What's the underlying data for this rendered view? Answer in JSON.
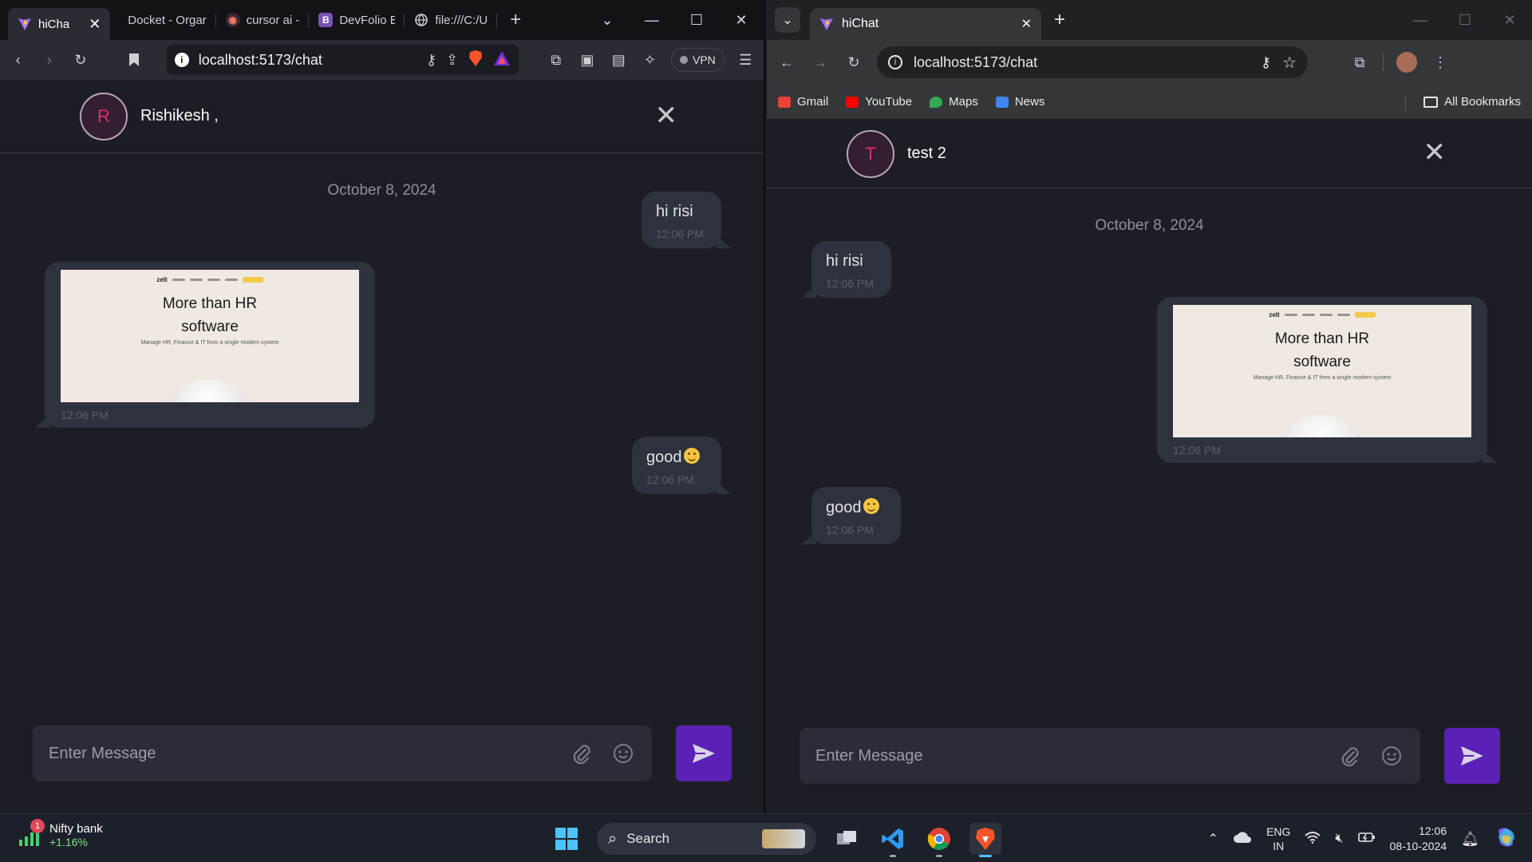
{
  "left_browser": {
    "tabs": [
      {
        "label": "hiCha",
        "active": true,
        "favicon": "vite-logo-icon"
      },
      {
        "label": "Docket - Orgar",
        "favicon": "none"
      },
      {
        "label": "cursor ai -",
        "favicon": "brave-search-icon"
      },
      {
        "label": "DevFolio E",
        "favicon": "bootstrap-icon"
      },
      {
        "label": "file:///C:/U",
        "favicon": "globe-icon"
      }
    ],
    "url": "localhost:5173/chat",
    "vpn_label": "VPN"
  },
  "right_browser": {
    "tab": {
      "label": "hiChat",
      "favicon": "vite-logo-icon"
    },
    "url": "localhost:5173/chat",
    "bookmarks": [
      {
        "label": "Gmail",
        "color": "#ea4335"
      },
      {
        "label": "YouTube",
        "color": "#ff0000"
      },
      {
        "label": "Maps",
        "color": "#34a853"
      },
      {
        "label": "News",
        "color": "#4285f4"
      }
    ],
    "all_bookmarks": "All Bookmarks"
  },
  "left_chat": {
    "contact": {
      "initial": "R",
      "name": "Rishikesh ,"
    },
    "date": "October 8, 2024",
    "messages": [
      {
        "text": "hi risi",
        "time": "12:06 PM",
        "dir": "out"
      },
      {
        "type": "image",
        "time": "12:06 PM",
        "dir": "in"
      },
      {
        "text": "good",
        "time": "12:06 PM",
        "dir": "out"
      }
    ],
    "input_placeholder": "Enter Message"
  },
  "right_chat": {
    "contact": {
      "initial": "T",
      "name": "test 2"
    },
    "date": "October 8, 2024",
    "messages": [
      {
        "text": "hi risi",
        "time": "12:06 PM",
        "dir": "in"
      },
      {
        "type": "image",
        "time": "12:06 PM",
        "dir": "out"
      },
      {
        "text": "good",
        "time": "12:06 PM",
        "dir": "in"
      }
    ],
    "input_placeholder": "Enter Message"
  },
  "image_preview": {
    "brand": "zelt",
    "headline_1": "More than HR",
    "headline_2": "software",
    "subline": "Manage HR, Finance & IT from a single modern system"
  },
  "taskbar": {
    "widget_name": "Nifty bank",
    "widget_change": "+1.16%",
    "widget_badge": "1",
    "search_label": "Search",
    "lang_1": "ENG",
    "lang_2": "IN",
    "time": "12:06",
    "date": "08-10-2024"
  },
  "colors": {
    "accent_send": "#5b21b6",
    "bubble": "#2e323c",
    "chat_bg": "#1d1e25",
    "avatar_letter": "#e0306e"
  }
}
